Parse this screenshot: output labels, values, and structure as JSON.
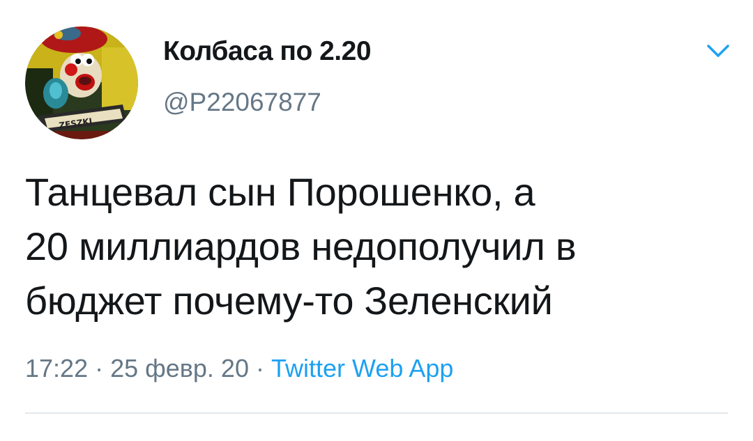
{
  "author": {
    "display_name": "Колбаса по 2.20",
    "handle": "@P22067877"
  },
  "tweet": {
    "text": "Танцевал сын Порошенко, а\n20 миллиардов недополучил в\nбюджет почему-то Зеленский",
    "time": "17:22",
    "separator": " · ",
    "date": "25 февр. 20",
    "source": "Twitter Web App"
  },
  "icons": {
    "menu": "chevron-down-icon",
    "avatar": "clown-avatar"
  },
  "colors": {
    "text": "#14171a",
    "secondary": "#657786",
    "accent": "#1da1f2",
    "divider": "#e1e8ed"
  }
}
